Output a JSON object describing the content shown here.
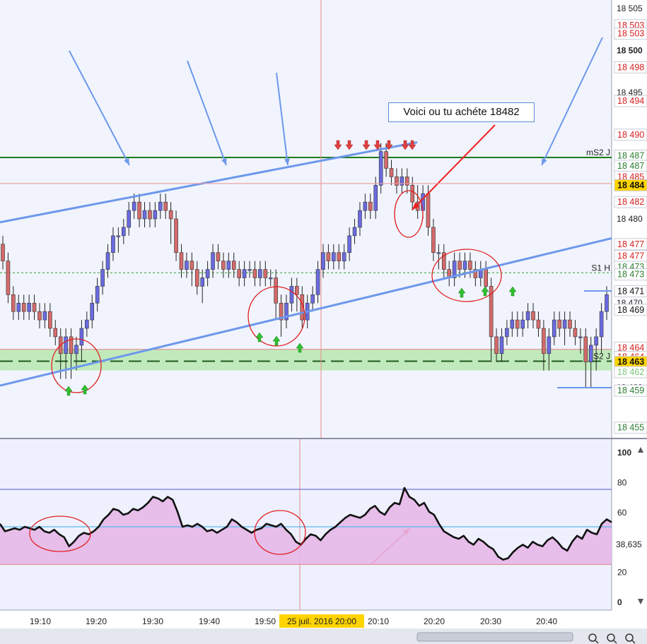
{
  "chart_data": [
    {
      "type": "candlestick",
      "panel": "price",
      "time_labels": [
        "19:10",
        "19:20",
        "19:30",
        "19:40",
        "19:50",
        "20:10",
        "20:20",
        "20:30",
        "20:40"
      ],
      "cursor_time_label": "25 juil. 2016 20:00",
      "price_axis": {
        "ylim": [
          18454,
          18506
        ],
        "tick_labels": [
          {
            "value": 18505,
            "text": "18 505",
            "style": "faint"
          },
          {
            "value": 18500,
            "text": "18 500",
            "style": "bold"
          },
          {
            "value": 18495,
            "text": "18 495",
            "style": "faint"
          },
          {
            "value": 18480,
            "text": "18 480",
            "style": "normal"
          },
          {
            "value": 18475,
            "text": "18 475",
            "style": "faint"
          },
          {
            "value": 18470,
            "text": "18 470",
            "style": "faint"
          },
          {
            "value": 18465,
            "text": "18 465",
            "style": "faint"
          },
          {
            "value": 18460,
            "text": "18 460",
            "style": "faint"
          }
        ],
        "boxed_labels": [
          {
            "value": 18503,
            "text": "18 503",
            "color": "#d62020"
          },
          {
            "value": 18502,
            "text": "18 503",
            "color": "#d62020"
          },
          {
            "value": 18498,
            "text": "18 498",
            "color": "#d62020"
          },
          {
            "value": 18494,
            "text": "18 494",
            "color": "#d62020"
          },
          {
            "value": 18490,
            "text": "18 490",
            "color": "#d62020"
          },
          {
            "value": 18487.5,
            "text": "18 487",
            "color": "#2e7d32"
          },
          {
            "value": 18486.3,
            "text": "18 487",
            "color": "#2e7d32"
          },
          {
            "value": 18485,
            "text": "18 485",
            "color": "#d62020"
          },
          {
            "value": 18484,
            "text": "18 484",
            "color": "#111111",
            "highlight": "#ffd400"
          },
          {
            "value": 18482,
            "text": "18 482",
            "color": "#d62020"
          },
          {
            "value": 18477,
            "text": "18 477",
            "color": "#d62020"
          },
          {
            "value": 18475.6,
            "text": "18 477",
            "color": "#d62020"
          },
          {
            "value": 18474.3,
            "text": "18 473",
            "color": "#2e7d32"
          },
          {
            "value": 18473.4,
            "text": "18 473",
            "color": "#2e7d32"
          },
          {
            "value": 18471.4,
            "text": "18 471",
            "color": "#111111"
          },
          {
            "value": 18469.2,
            "text": "18 469",
            "color": "#111111"
          },
          {
            "value": 18464.7,
            "text": "18 464",
            "color": "#d62020"
          },
          {
            "value": 18463.6,
            "text": "18 464",
            "color": "#d62020"
          },
          {
            "value": 18463,
            "text": "18 463",
            "color": "#111111",
            "highlight": "#ffd400"
          },
          {
            "value": 18461.8,
            "text": "18 462",
            "color": "#7cc47c"
          },
          {
            "value": 18459.6,
            "text": "18 459",
            "color": "#2e7d32"
          },
          {
            "value": 18455.2,
            "text": "18 455",
            "color": "#2e7d32"
          }
        ]
      },
      "candles": [
        [
          18477,
          18475,
          18478,
          18474
        ],
        [
          18475,
          18471,
          18476,
          18470
        ],
        [
          18471,
          18469,
          18472,
          18468
        ],
        [
          18469,
          18470,
          18471,
          18468
        ],
        [
          18470,
          18469,
          18471,
          18468
        ],
        [
          18469,
          18470,
          18471,
          18468
        ],
        [
          18470,
          18469,
          18471,
          18468
        ],
        [
          18469,
          18468,
          18470,
          18467
        ],
        [
          18468,
          18469,
          18470,
          18467
        ],
        [
          18469,
          18467,
          18470,
          18466
        ],
        [
          18467,
          18466,
          18468,
          18465
        ],
        [
          18466,
          18464,
          18467,
          18461
        ],
        [
          18464,
          18466,
          18467,
          18461
        ],
        [
          18466,
          18464,
          18467,
          18461
        ],
        [
          18464,
          18465,
          18466,
          18462
        ],
        [
          18465,
          18467,
          18468,
          18463
        ],
        [
          18467,
          18468,
          18469,
          18466
        ],
        [
          18468,
          18470,
          18471,
          18467
        ],
        [
          18470,
          18472,
          18473,
          18469
        ],
        [
          18472,
          18474,
          18475,
          18471
        ],
        [
          18474,
          18476,
          18477,
          18473
        ],
        [
          18476,
          18478,
          18479,
          18475
        ],
        [
          18478,
          18478,
          18479,
          18476
        ],
        [
          18478,
          18479,
          18480,
          18477
        ],
        [
          18479,
          18481,
          18482,
          18478
        ],
        [
          18481,
          18482,
          18483,
          18480
        ],
        [
          18482,
          18480,
          18483,
          18479
        ],
        [
          18480,
          18481,
          18482,
          18479
        ],
        [
          18481,
          18480,
          18482,
          18479
        ],
        [
          18480,
          18481,
          18482,
          18479
        ],
        [
          18481,
          18482,
          18483,
          18480
        ],
        [
          18482,
          18481,
          18483,
          18480
        ],
        [
          18481,
          18480,
          18482,
          18477
        ],
        [
          18480,
          18476,
          18481,
          18475
        ],
        [
          18476,
          18474,
          18477,
          18473
        ],
        [
          18474,
          18475,
          18476,
          18473
        ],
        [
          18475,
          18474,
          18476,
          18472
        ],
        [
          18474,
          18472,
          18475,
          18471
        ],
        [
          18472,
          18473,
          18474,
          18470
        ],
        [
          18473,
          18474,
          18475,
          18472
        ],
        [
          18474,
          18476,
          18477,
          18473
        ],
        [
          18476,
          18475,
          18477,
          18474
        ],
        [
          18475,
          18474,
          18476,
          18473
        ],
        [
          18474,
          18475,
          18476,
          18473
        ],
        [
          18475,
          18474,
          18476,
          18473
        ],
        [
          18474,
          18473,
          18475,
          18472
        ],
        [
          18473,
          18474,
          18475,
          18472
        ],
        [
          18474,
          18474,
          18475,
          18473
        ],
        [
          18474,
          18473,
          18475,
          18472
        ],
        [
          18473,
          18474,
          18475,
          18472
        ],
        [
          18474,
          18473,
          18475,
          18472
        ],
        [
          18473,
          18473,
          18474,
          18472
        ],
        [
          18473,
          18470,
          18474,
          18468
        ],
        [
          18470,
          18468,
          18471,
          18466
        ],
        [
          18468,
          18470,
          18471,
          18467
        ],
        [
          18470,
          18472,
          18473,
          18469
        ],
        [
          18472,
          18471,
          18473,
          18469
        ],
        [
          18471,
          18468,
          18472,
          18467
        ],
        [
          18468,
          18470,
          18471,
          18467
        ],
        [
          18470,
          18471,
          18472,
          18469
        ],
        [
          18471,
          18474,
          18475,
          18470
        ],
        [
          18474,
          18476,
          18477,
          18473
        ],
        [
          18476,
          18475,
          18477,
          18474
        ],
        [
          18475,
          18476,
          18477,
          18474
        ],
        [
          18476,
          18475,
          18477,
          18474
        ],
        [
          18475,
          18476,
          18477,
          18474
        ],
        [
          18476,
          18478,
          18479,
          18475
        ],
        [
          18478,
          18479,
          18480,
          18477
        ],
        [
          18479,
          18481,
          18482,
          18478
        ],
        [
          18481,
          18482,
          18483,
          18480
        ],
        [
          18482,
          18481,
          18483,
          18480
        ],
        [
          18481,
          18484,
          18485,
          18480
        ],
        [
          18484,
          18488,
          18489,
          18483
        ],
        [
          18488,
          18486,
          18489,
          18485
        ],
        [
          18486,
          18485,
          18487,
          18484
        ],
        [
          18485,
          18484,
          18486,
          18483
        ],
        [
          18484,
          18485,
          18486,
          18483
        ],
        [
          18485,
          18484,
          18486,
          18483
        ],
        [
          18484,
          18482,
          18485,
          18481
        ],
        [
          18482,
          18481,
          18484,
          18480
        ],
        [
          18481,
          18483,
          18484,
          18480
        ],
        [
          18483,
          18479,
          18484,
          18478
        ],
        [
          18479,
          18476,
          18480,
          18475
        ],
        [
          18476,
          18476,
          18477,
          18474
        ],
        [
          18476,
          18474,
          18477,
          18473
        ],
        [
          18474,
          18473,
          18475,
          18472
        ],
        [
          18473,
          18475,
          18476,
          18472
        ],
        [
          18475,
          18474,
          18476,
          18473
        ],
        [
          18474,
          18475,
          18476,
          18473
        ],
        [
          18475,
          18474,
          18476,
          18473
        ],
        [
          18474,
          18473,
          18475,
          18472
        ],
        [
          18473,
          18474,
          18475,
          18472
        ],
        [
          18474,
          18472,
          18475,
          18471
        ],
        [
          18472,
          18466,
          18473,
          18463
        ],
        [
          18466,
          18464,
          18467,
          18463
        ],
        [
          18464,
          18466,
          18467,
          18463
        ],
        [
          18466,
          18467,
          18468,
          18465
        ],
        [
          18467,
          18468,
          18469,
          18466
        ],
        [
          18468,
          18467,
          18469,
          18466
        ],
        [
          18467,
          18468,
          18469,
          18466
        ],
        [
          18468,
          18469,
          18470,
          18467
        ],
        [
          18469,
          18468,
          18470,
          18467
        ],
        [
          18468,
          18467,
          18469,
          18466
        ],
        [
          18467,
          18464,
          18468,
          18462
        ],
        [
          18464,
          18466,
          18467,
          18462
        ],
        [
          18466,
          18468,
          18469,
          18465
        ],
        [
          18468,
          18467,
          18469,
          18466
        ],
        [
          18467,
          18468,
          18469,
          18465
        ],
        [
          18468,
          18467,
          18469,
          18466
        ],
        [
          18467,
          18466,
          18468,
          18465
        ],
        [
          18466,
          18466,
          18467,
          18464
        ],
        [
          18466,
          18463,
          18467,
          18460
        ],
        [
          18463,
          18465,
          18466,
          18460
        ],
        [
          18465,
          18466,
          18467,
          18462
        ],
        [
          18466,
          18469,
          18470,
          18464
        ],
        [
          18469,
          18471,
          18472,
          18468
        ]
      ],
      "bull_color": "#6a6ae0",
      "bear_color": "#d46a6a",
      "horizontal_levels": [
        {
          "name": "mS2 J",
          "value": 18487.3,
          "color": "#1e7a1e",
          "style": "solid"
        },
        {
          "name": "S1 H",
          "value": 18473.6,
          "color": "#2ea02e",
          "style": "dotted"
        },
        {
          "name": "S2 J",
          "value": 18463.1,
          "color": "#1e5c1e",
          "style": "dashed"
        },
        {
          "name": "",
          "value": 18484.2,
          "color": "#f0a0a0",
          "style": "thin"
        }
      ],
      "support_zone": [
        18462.0,
        18464.5
      ],
      "trendlines": [
        {
          "from": [
            0,
            18479.6
          ],
          "to": [
            590,
            18489.1
          ]
        },
        {
          "from": [
            0,
            18460.2
          ],
          "to": [
            865,
            18477.7
          ]
        }
      ],
      "annotation_text": "Voici ou tu achéte 18482"
    },
    {
      "type": "line",
      "panel": "oscillator",
      "ylim": [
        0,
        100
      ],
      "ytick_labels": [
        "100",
        "80",
        "60",
        "40",
        "20",
        "0"
      ],
      "current_value_label": "38,635",
      "levels": [
        {
          "value": 75,
          "color": "#5555cc"
        },
        {
          "value": 50,
          "color": "#55bbee"
        },
        {
          "value": 25,
          "color": "#dd3333"
        }
      ],
      "values": [
        52,
        47,
        48,
        49,
        48,
        50,
        49,
        48,
        50,
        47,
        46,
        48,
        45,
        43,
        37,
        40,
        44,
        46,
        45,
        47,
        50,
        55,
        58,
        62,
        61,
        58,
        59,
        62,
        61,
        63,
        66,
        70,
        69,
        67,
        70,
        68,
        60,
        50,
        51,
        50,
        52,
        50,
        47,
        48,
        46,
        48,
        50,
        55,
        53,
        50,
        48,
        46,
        48,
        49,
        52,
        51,
        50,
        52,
        48,
        45,
        40,
        38,
        42,
        45,
        44,
        41,
        45,
        48,
        50,
        53,
        56,
        58,
        57,
        56,
        58,
        62,
        64,
        60,
        58,
        63,
        66,
        65,
        76,
        70,
        68,
        64,
        66,
        60,
        58,
        52,
        47,
        45,
        43,
        42,
        44,
        40,
        38,
        42,
        40,
        37,
        35,
        30,
        28,
        29,
        33,
        36,
        38,
        36,
        40,
        38,
        37,
        41,
        43,
        40,
        36,
        34,
        40,
        44,
        42,
        48,
        46,
        45,
        52,
        55,
        53
      ]
    }
  ]
}
